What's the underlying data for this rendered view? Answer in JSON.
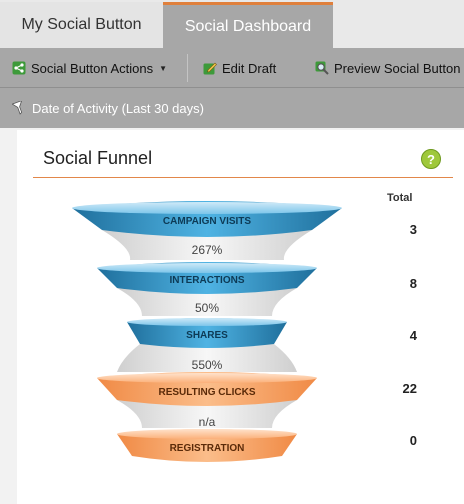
{
  "tabs": [
    {
      "label": "My Social Button"
    },
    {
      "label": "Social Dashboard"
    }
  ],
  "toolbar": {
    "actions_label": "Social Button Actions",
    "edit_label": "Edit Draft",
    "preview_label": "Preview Social Button"
  },
  "filter": {
    "label": "Date of Activity (Last 30 days)"
  },
  "panel": {
    "title": "Social Funnel",
    "help_symbol": "?"
  },
  "funnel": {
    "total_label": "Total",
    "stages": [
      {
        "label": "CAMPAIGN VISITS",
        "total": "3",
        "color": "blue"
      },
      {
        "label": "INTERACTIONS",
        "total": "8",
        "color": "blue"
      },
      {
        "label": "SHARES",
        "total": "4",
        "color": "blue"
      },
      {
        "label": "RESULTING CLICKS",
        "total": "22",
        "color": "orange"
      },
      {
        "label": "REGISTRATION",
        "total": "0",
        "color": "orange"
      }
    ],
    "conversions": [
      "267%",
      "50%",
      "550%",
      "n/a"
    ]
  },
  "colors": {
    "blue": "#3d9ac9",
    "orange": "#f7a46b",
    "accent": "#e0803c"
  }
}
